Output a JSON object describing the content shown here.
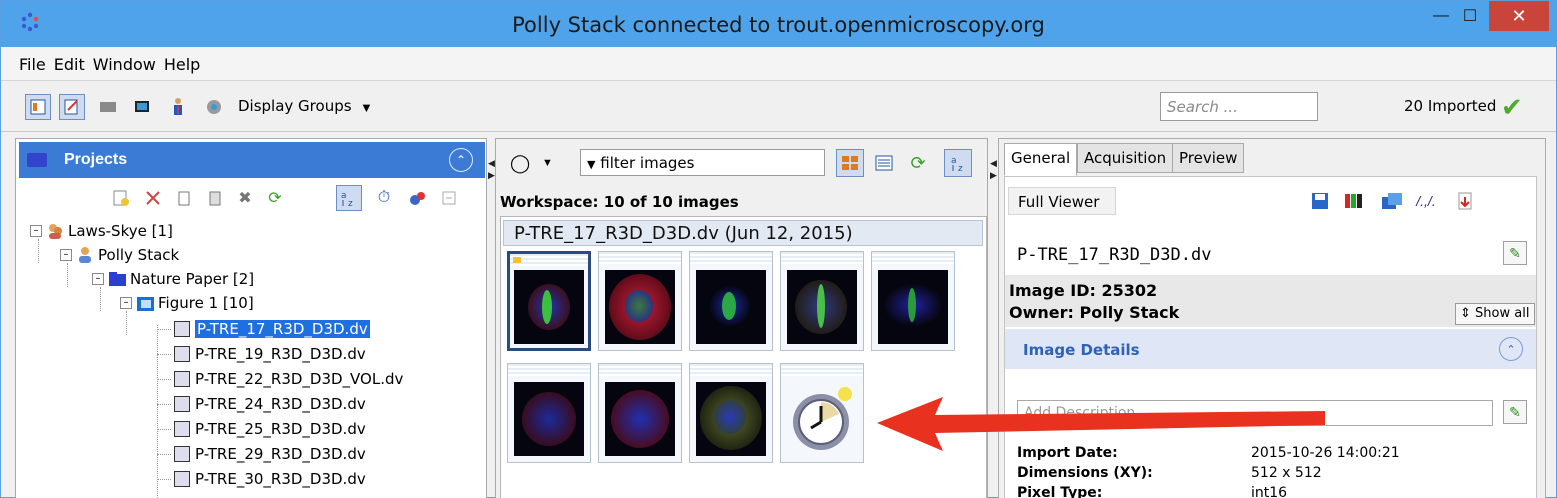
{
  "window": {
    "title": "Polly Stack connected to trout.openmicroscopy.org",
    "min_icon": "minimize-icon",
    "max_icon": "maximize-icon",
    "close_icon": "close-icon"
  },
  "menu": {
    "items": [
      "File",
      "Edit",
      "Window",
      "Help"
    ]
  },
  "toolbar": {
    "display_groups": "Display Groups",
    "search_placeholder": "Search ...",
    "imported": "20 Imported"
  },
  "projects": {
    "title": "Projects",
    "tree": [
      {
        "label": "Laws-Skye [1]",
        "icon": "group-icon"
      },
      {
        "label": "Polly Stack",
        "icon": "user-icon"
      },
      {
        "label": "Nature Paper [2]",
        "icon": "project-icon"
      },
      {
        "label": "Figure 1 [10]",
        "icon": "dataset-icon"
      },
      {
        "label": "P-TRE_17_R3D_D3D.dv",
        "icon": "image-file-icon",
        "selected": true
      },
      {
        "label": "P-TRE_19_R3D_D3D.dv",
        "icon": "image-file-icon"
      },
      {
        "label": "P-TRE_22_R3D_D3D_VOL.dv",
        "icon": "image-file-icon"
      },
      {
        "label": "P-TRE_24_R3D_D3D.dv",
        "icon": "image-file-icon"
      },
      {
        "label": "P-TRE_25_R3D_D3D.dv",
        "icon": "image-file-icon"
      },
      {
        "label": "P-TRE_29_R3D_D3D.dv",
        "icon": "image-file-icon"
      },
      {
        "label": "P-TRE_30_R3D_D3D.dv",
        "icon": "image-file-icon"
      }
    ]
  },
  "center": {
    "filter_text": "filter  images",
    "workspace": "Workspace: 10 of 10 images",
    "group_header": "P-TRE_17_R3D_D3D.dv (Jun 12, 2015)"
  },
  "right": {
    "tabs": [
      "General",
      "Acquisition",
      "Preview"
    ],
    "full_viewer": "Full Viewer",
    "image_name": "P-TRE_17_R3D_D3D.dv",
    "image_id": "Image ID: 25302",
    "owner": "Owner: Polly Stack",
    "show_all": "Show all",
    "image_details": "Image Details",
    "add_description": "Add Description",
    "import_date_label": "Import Date:",
    "import_date": "2015-10-26 14:00:21",
    "dimensions_label": "Dimensions (XY):",
    "dimensions": "512 x 512",
    "pixel_type_label": "Pixel Type:",
    "pixel_type": "int16"
  },
  "colors": {
    "titlebar": "#4fa3ea",
    "selection": "#1e6fe0",
    "annotation_arrow": "#e8311f"
  }
}
